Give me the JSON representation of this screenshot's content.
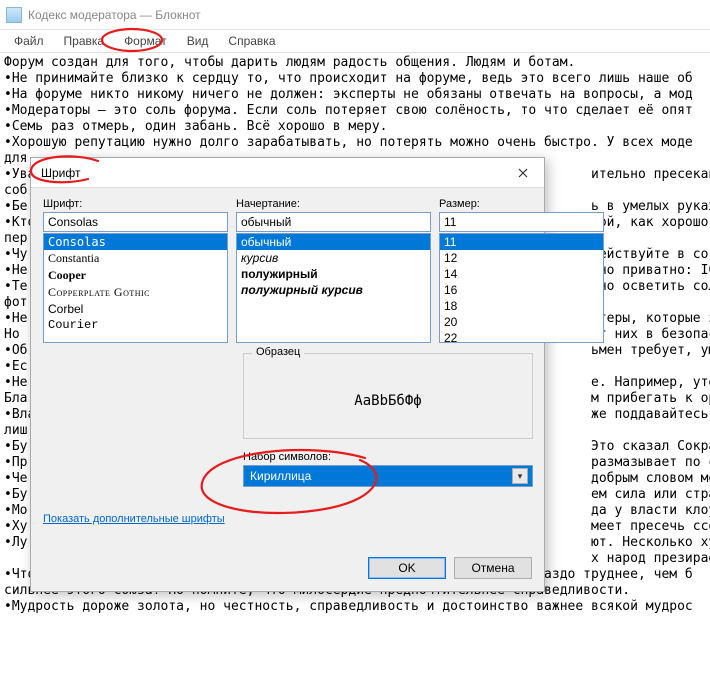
{
  "window": {
    "title": "Кодекс модератора — Блокнот"
  },
  "menus": {
    "file": "Файл",
    "edit": "Правка",
    "format": "Формат",
    "view": "Вид",
    "help": "Справка"
  },
  "editor": {
    "lines": [
      "Форум создан для того, чтобы дарить людям радость общения. Людям и ботам.",
      "•Не принимайте близко к сердцу то, что происходит на форуме, ведь это всего лишь наше об",
      "•На форуме никто никому ничего не должен: эксперты не обязаны отвечать на вопросы, а мод",
      "•Модераторы — это соль форума. Если соль потеряет свою солёность, то что сделает её опят",
      "•Семь раз отмерь, один забань. Всё хорошо в меру.",
      "•Хорошую репутацию нужно долго зарабатывать, но потерять можно очень быстро. У всех моде",
      "для                                                                        ",
      "•Ува                                                                       ительно пресекайте н",
      "соб                                                                        ",
      "•Бе                                                                        ь в умелых руках и в о",
      "•Кто                                                                       рой, как хорошо зато",
      "пер                                                                        ",
      "•Чу                                                                        Действуйте в согласи",
      "•Не                                                                        ьно приватно: ICQ, м",
      "•Те                                                                        жно осветить солнцем",
      "фот                                                                        ",
      "•Не                                                                        нтеры, которые запро",
      "Но                                                                         от них в безопаснос",
      "•Об                                                                        ьмен требует, умерен",
      "•Ес                                                                        ",
      "•Не                                                                        е. Например, утопить",
      "Бла                                                                        м прибегать к оружию",
      "•Вла                                                                       же поддавайтесь развр",
      "лиш                                                                        ",
      "•Бу                                                                        Это сказал Сократ и ",
      "•Пр                                                                        размазывает по стене",
      "•Че                                                                        добрым словом можно ",
      "•Бу                                                                        ем сила или страсть",
      "•Мо                                                                        да у власти клоуны, ",
      "•Ху                                                                        меет пресечь ссору в з",
      "•Лу                                                                        ют. Несколько хуже ",
      "                                                                           х народ презирает.",
      "•Чтобы модератор был счастливым, он должен быть справедливым, что гораздо труднее, чем б",
      "сильнее этого союза? Но помните, что милосердие предпочтительнее справедливости.",
      "•Мудрость дороже золота, но честность, справедливость и достоинство важнее всякой мудрос"
    ]
  },
  "dialog": {
    "title": "Шрифт",
    "font_label": "Шрифт:",
    "style_label": "Начертание:",
    "size_label": "Размер:",
    "font_value": "Consolas",
    "style_value": "обычный",
    "size_value": "11",
    "font_list": [
      "Consolas",
      "Constantia",
      "Cooper",
      "Copperplate Gothic",
      "Corbel",
      "Courier"
    ],
    "style_list": [
      "обычный",
      "курсив",
      "полужирный",
      "полужирный курсив"
    ],
    "size_list": [
      "11",
      "12",
      "14",
      "16",
      "18",
      "20",
      "22"
    ],
    "sample_label": "Образец",
    "sample_text": "AaBbБбФф",
    "charset_label": "Набор символов:",
    "charset_value": "Кириллица",
    "more_fonts_link": "Показать дополнительные шрифты",
    "ok": "OK",
    "cancel": "Отмена"
  }
}
